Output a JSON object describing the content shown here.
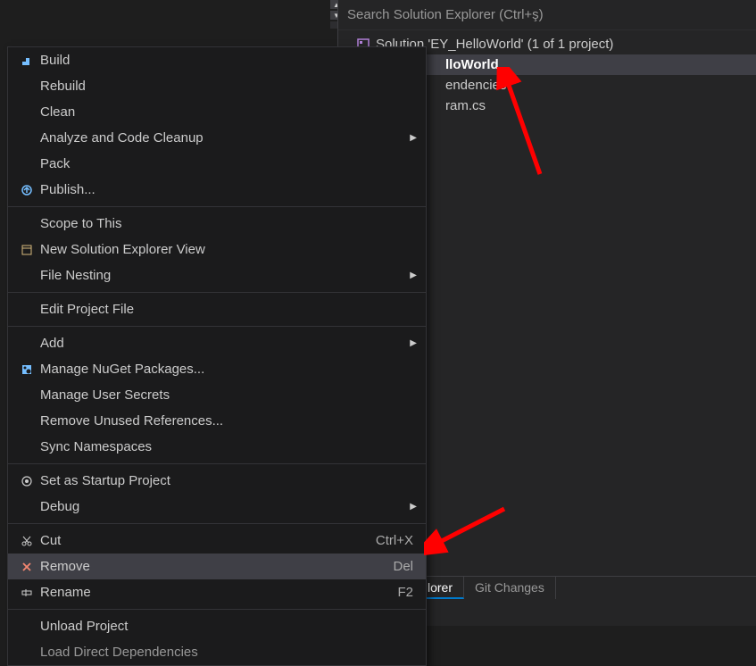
{
  "search": {
    "placeholder": "Search Solution Explorer (Ctrl+ş)"
  },
  "solution": {
    "label": "Solution 'EY_HelloWorld' (1 of 1 project)",
    "project_partial": "lloWorld",
    "dependencies_partial": "endencies",
    "program_partial": "ram.cs"
  },
  "context_menu": {
    "build": "Build",
    "rebuild": "Rebuild",
    "clean": "Clean",
    "analyze": "Analyze and Code Cleanup",
    "pack": "Pack",
    "publish": "Publish...",
    "scope": "Scope to This",
    "new_view": "New Solution Explorer View",
    "file_nesting": "File Nesting",
    "edit_project": "Edit Project File",
    "add": "Add",
    "nuget": "Manage NuGet Packages...",
    "user_secrets": "Manage User Secrets",
    "remove_refs": "Remove Unused References...",
    "sync_ns": "Sync Namespaces",
    "startup": "Set as Startup Project",
    "debug": "Debug",
    "cut": "Cut",
    "cut_shortcut": "Ctrl+X",
    "remove": "Remove",
    "remove_shortcut": "Del",
    "rename": "Rename",
    "rename_shortcut": "F2",
    "unload": "Unload Project",
    "load_deps": "Load Direct Dependencies"
  },
  "tabs": {
    "solution_explorer_partial": "lorer",
    "git_changes": "Git Changes"
  }
}
